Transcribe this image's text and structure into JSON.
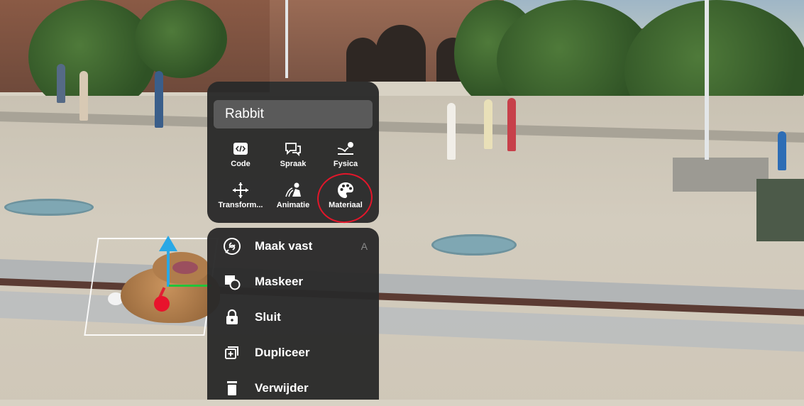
{
  "object_menu": {
    "title": "Rabbit",
    "tools": [
      {
        "label": "Code",
        "icon": "code-icon"
      },
      {
        "label": "Spraak",
        "icon": "speech-bubble-icon"
      },
      {
        "label": "Fysica",
        "icon": "physics-icon"
      },
      {
        "label": "Transform...",
        "icon": "move-arrows-icon"
      },
      {
        "label": "Animatie",
        "icon": "animation-icon"
      },
      {
        "label": "Materiaal",
        "icon": "palette-icon"
      }
    ],
    "highlighted_tool": "Materiaal",
    "highlight_color": "#e3162a"
  },
  "actions_menu": {
    "items": [
      {
        "label": "Maak vast",
        "icon": "anchor-link-icon",
        "shortcut": "A"
      },
      {
        "label": "Maskeer",
        "icon": "mask-icon"
      },
      {
        "label": "Sluit",
        "icon": "lock-icon"
      },
      {
        "label": "Dupliceer",
        "icon": "duplicate-icon"
      },
      {
        "label": "Verwijder",
        "icon": "trash-icon"
      }
    ]
  },
  "gizmo": {
    "up_axis_color": "#29a8e6",
    "x_axis_color": "#22c43a",
    "z_axis_color": "#e8132c"
  }
}
